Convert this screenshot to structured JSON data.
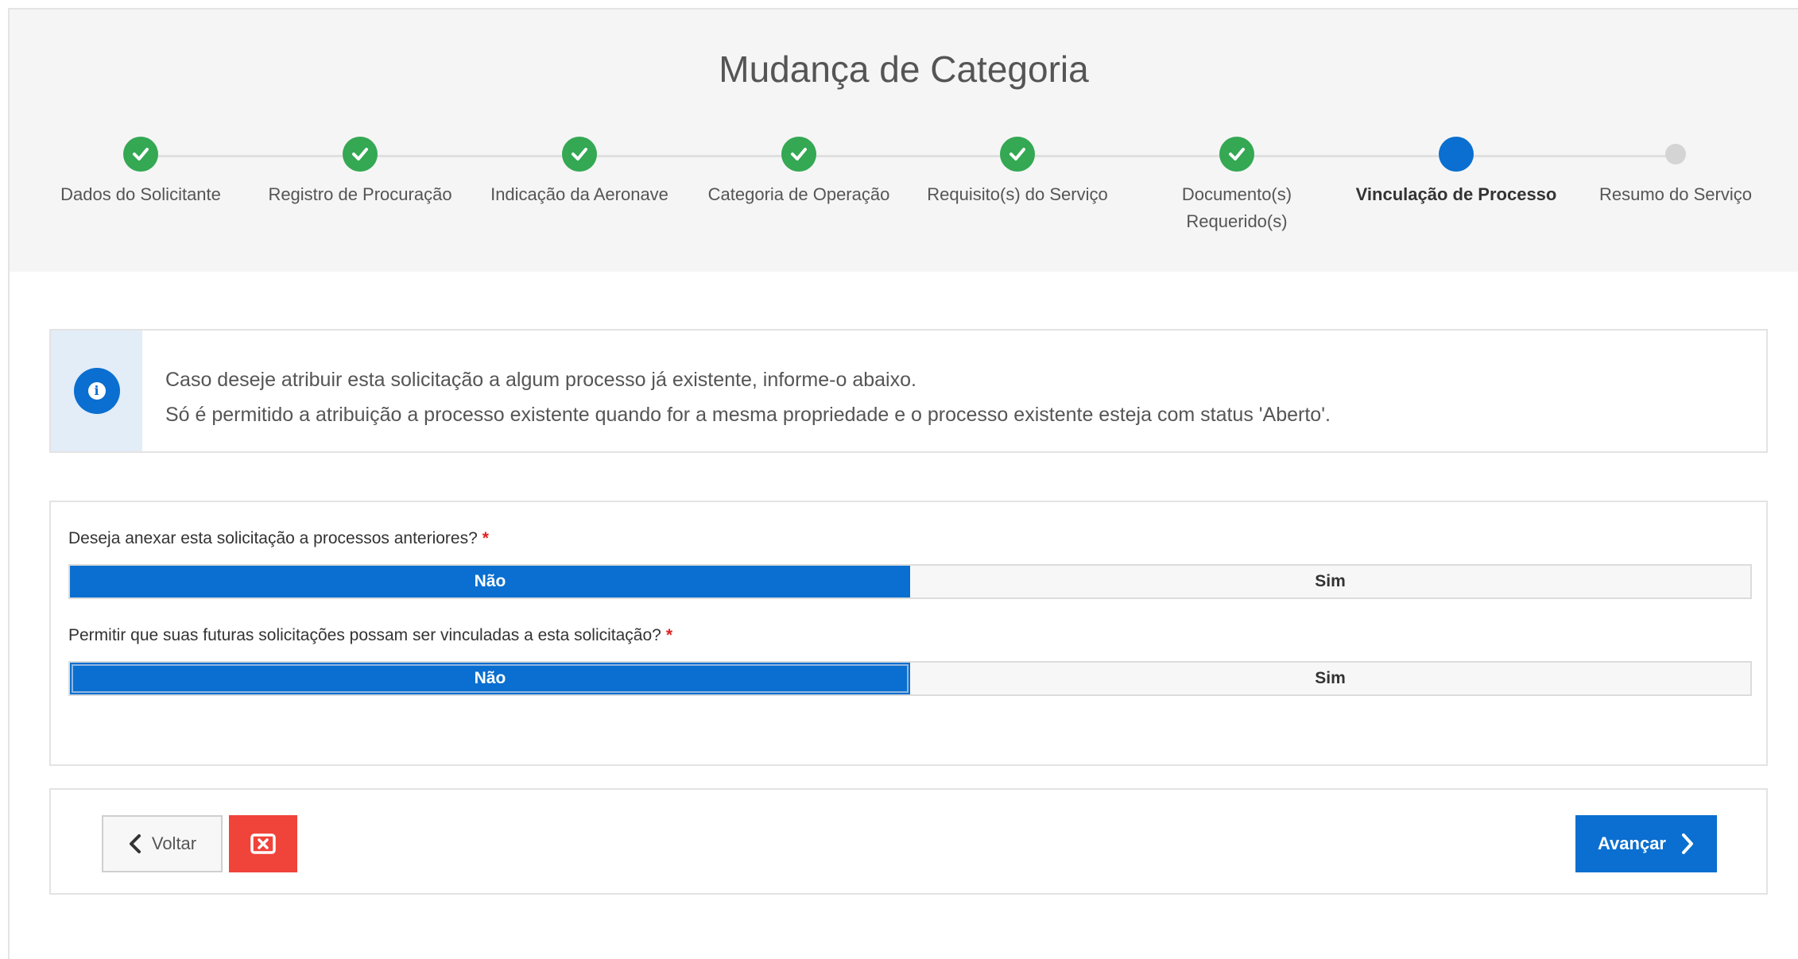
{
  "header": {
    "title": "Mudança de Categoria"
  },
  "stepper": {
    "steps": [
      {
        "label": "Dados do Solicitante",
        "status": "done"
      },
      {
        "label": "Registro de Procuração",
        "status": "done"
      },
      {
        "label": "Indicação da Aeronave",
        "status": "done"
      },
      {
        "label": "Categoria de Operação",
        "status": "done"
      },
      {
        "label": "Requisito(s) do Serviço",
        "status": "done"
      },
      {
        "label": "Documento(s) Requerido(s)",
        "label_line1": "Documento(s)",
        "label_line2": "Requerido(s)",
        "status": "done"
      },
      {
        "label": "Vinculação de Processo",
        "status": "active"
      },
      {
        "label": "Resumo do Serviço",
        "status": "pending"
      }
    ]
  },
  "info": {
    "icon": "info-icon",
    "line1": "Caso deseje atribuir esta solicitação a algum processo já existente, informe-o abaixo.",
    "line2": "Só é permitido a atribuição a processo existente quando for a mesma propriedade e o processo existente esteja com status 'Aberto'."
  },
  "form": {
    "q1": {
      "label": "Deseja anexar esta solicitação a processos anteriores?",
      "required_mark": "*",
      "options": [
        "Não",
        "Sim"
      ],
      "selected": "Não"
    },
    "q2": {
      "label": "Permitir que suas futuras solicitações possam ser vinculadas a esta solicitação?",
      "required_mark": "*",
      "options": [
        "Não",
        "Sim"
      ],
      "selected": "Não"
    }
  },
  "actions": {
    "back_label": "Voltar",
    "cancel_icon": "close-box-icon",
    "next_label": "Avançar"
  },
  "colors": {
    "primary": "#0a6fd0",
    "success": "#34a853",
    "danger": "#f0433a",
    "required": "#e02020"
  }
}
